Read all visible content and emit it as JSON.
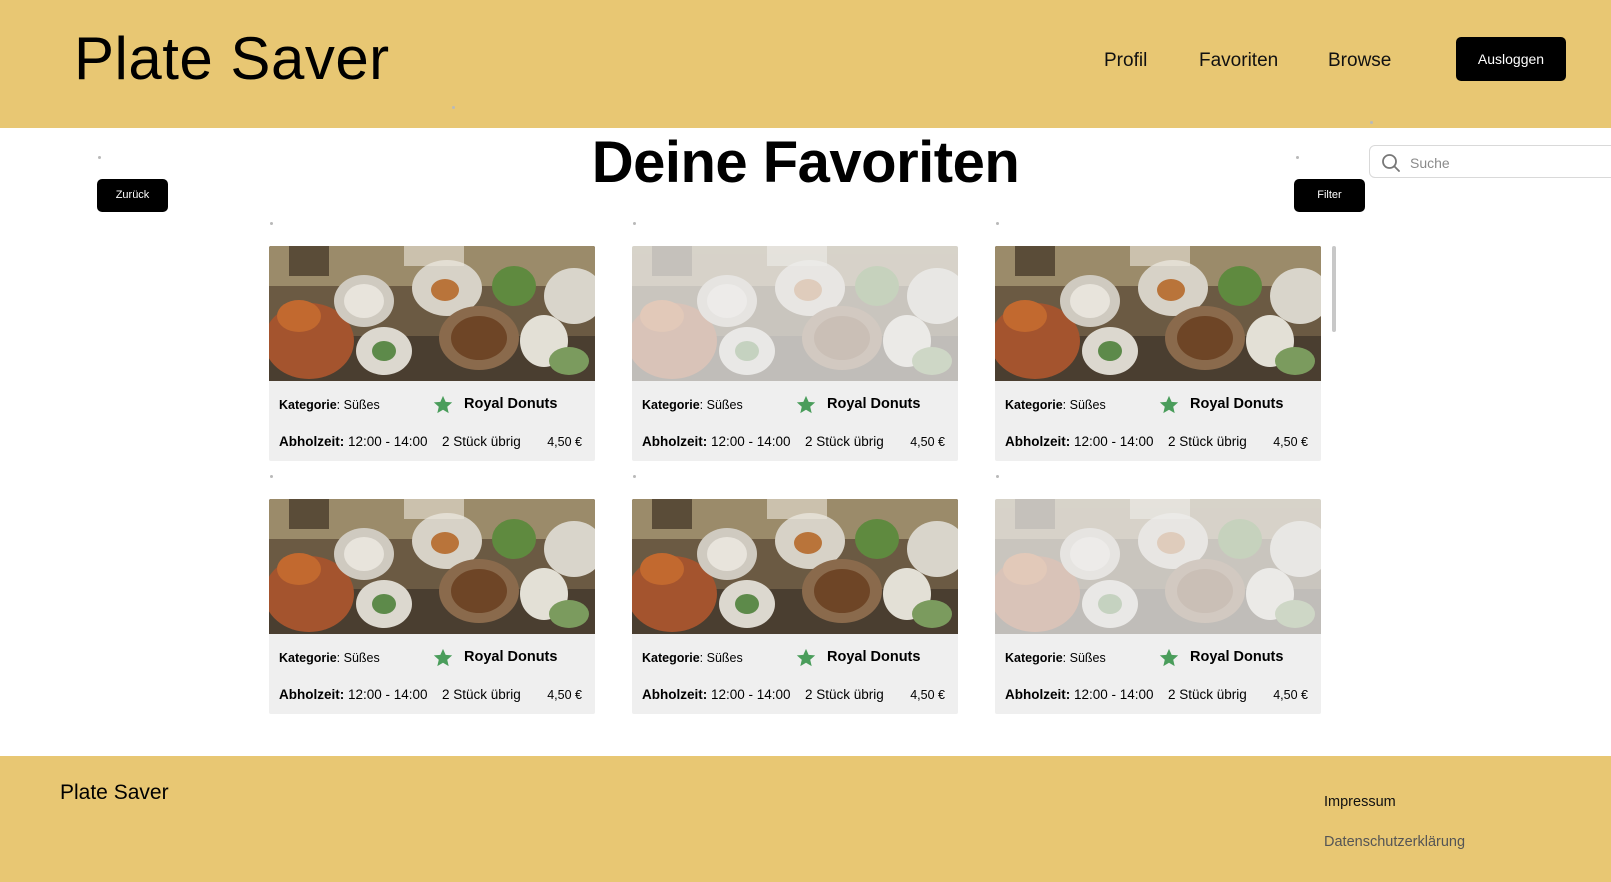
{
  "header": {
    "brand": "Plate Saver",
    "nav": [
      "Profil",
      "Favoriten",
      "Browse"
    ],
    "logout_label": "Ausloggen"
  },
  "main": {
    "title": "Deine Favoriten",
    "back_label": "Zurück",
    "filter_label": "Filter",
    "search_placeholder": "Suche",
    "cards": [
      {
        "category_label": "Kategorie",
        "category": ": Süßes",
        "store": "Royal Donuts",
        "pickup_label": "Abholzeit:",
        "pickup": " 12:00 - 14:00",
        "stock": "2 Stück übrig",
        "price": "4,50 €",
        "faded": false
      },
      {
        "category_label": "Kategorie",
        "category": ": Süßes",
        "store": "Royal Donuts",
        "pickup_label": "Abholzeit:",
        "pickup": " 12:00 - 14:00",
        "stock": "2 Stück übrig",
        "price": "4,50 €",
        "faded": true
      },
      {
        "category_label": "Kategorie",
        "category": ": Süßes",
        "store": "Royal Donuts",
        "pickup_label": "Abholzeit:",
        "pickup": " 12:00 - 14:00",
        "stock": "2 Stück übrig",
        "price": "4,50 €",
        "faded": false
      },
      {
        "category_label": "Kategorie",
        "category": ": Süßes",
        "store": "Royal Donuts",
        "pickup_label": "Abholzeit:",
        "pickup": " 12:00 - 14:00",
        "stock": "2 Stück übrig",
        "price": "4,50 €",
        "faded": false
      },
      {
        "category_label": "Kategorie",
        "category": ": Süßes",
        "store": "Royal Donuts",
        "pickup_label": "Abholzeit:",
        "pickup": " 12:00 - 14:00",
        "stock": "2 Stück übrig",
        "price": "4,50 €",
        "faded": false
      },
      {
        "category_label": "Kategorie",
        "category": ": Süßes",
        "store": "Royal Donuts",
        "pickup_label": "Abholzeit:",
        "pickup": " 12:00 - 14:00",
        "stock": "2 Stück übrig",
        "price": "4,50 €",
        "faded": true
      }
    ]
  },
  "footer": {
    "brand": "Plate Saver",
    "links": [
      "Impressum",
      "Datenschutzerklärung"
    ]
  },
  "colors": {
    "brand_yellow": "#e8c773",
    "button_black": "#000000",
    "card_bg": "#efefef",
    "favorite_star": "#4a9d5b"
  },
  "icons": {
    "search": "search-icon",
    "favorite": "star-icon"
  }
}
